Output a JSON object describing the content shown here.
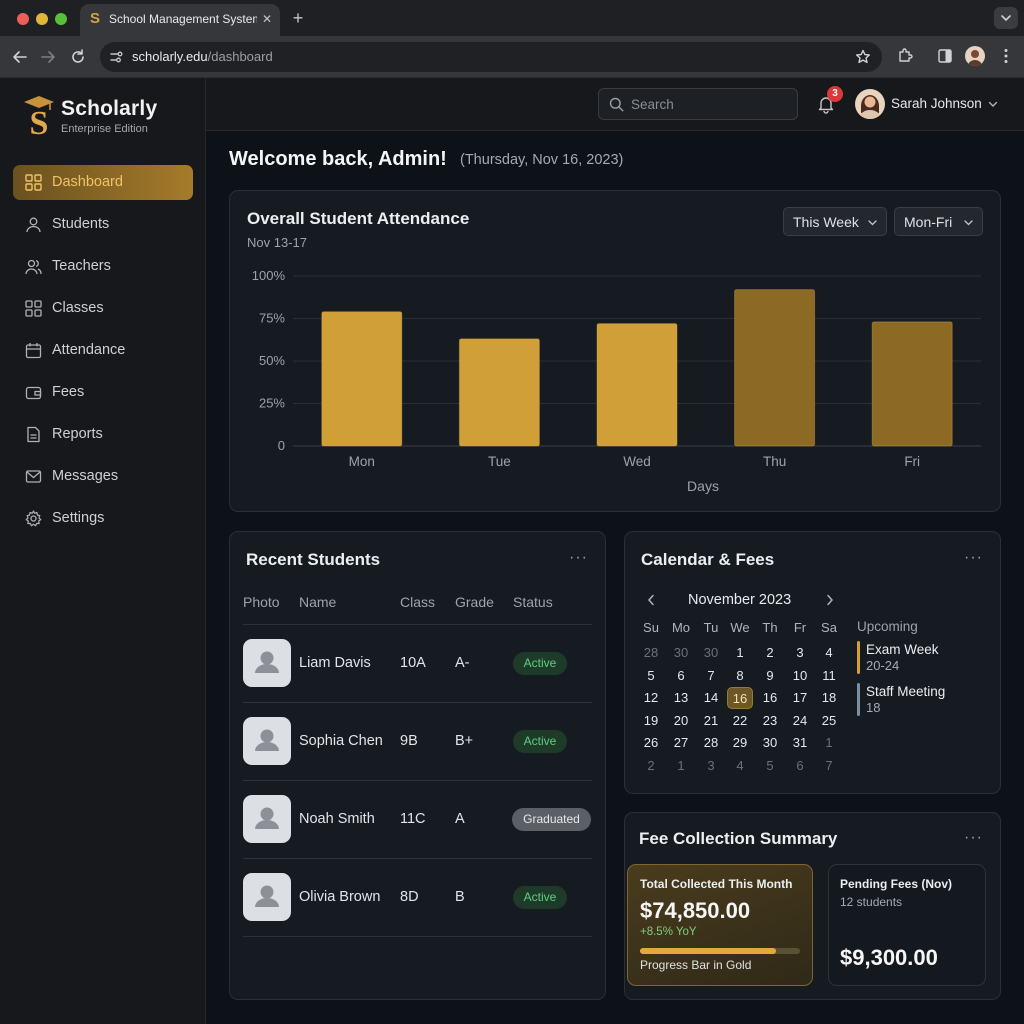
{
  "browser": {
    "tab_title": "School Management System",
    "url_host": "scholarly.edu",
    "url_path": "/dashboard"
  },
  "brand": {
    "name": "Scholarly",
    "subtitle": "Enterprise Edition",
    "accent": "#d6a43d"
  },
  "sidebar": {
    "items": [
      {
        "label": "Dashboard",
        "icon": "grid-icon",
        "active": true
      },
      {
        "label": "Students",
        "icon": "user-icon"
      },
      {
        "label": "Teachers",
        "icon": "users-icon"
      },
      {
        "label": "Classes",
        "icon": "grid-icon"
      },
      {
        "label": "Attendance",
        "icon": "calendar-icon"
      },
      {
        "label": "Fees",
        "icon": "wallet-icon"
      },
      {
        "label": "Reports",
        "icon": "file-icon"
      },
      {
        "label": "Messages",
        "icon": "mail-icon"
      },
      {
        "label": "Settings",
        "icon": "gear-icon"
      }
    ]
  },
  "header": {
    "search_placeholder": "Search",
    "notification_count": "3",
    "user_name": "Sarah Johnson"
  },
  "welcome": {
    "title": "Welcome back, Admin!",
    "date": "(Thursday, Nov 16, 2023)"
  },
  "attendance": {
    "title": "Overall Student Attendance",
    "subtitle": "Nov 13-17",
    "range_select": "This Week",
    "days_select": "Mon-Fri"
  },
  "chart_data": {
    "type": "bar",
    "title": "Overall Student Attendance",
    "subtitle": "Nov 13-17",
    "categories": [
      "Mon",
      "Tue",
      "Wed",
      "Thu",
      "Fri"
    ],
    "values": [
      79,
      63,
      72,
      92,
      73
    ],
    "ytick_labels": [
      "0",
      "25%",
      "50%",
      "75%",
      "100%"
    ],
    "yticks": [
      0,
      25,
      50,
      75,
      100
    ],
    "ylim": [
      0,
      100
    ],
    "xlabel": "Days",
    "ylabel": "",
    "grid": true,
    "bar_colors": [
      "#d19f37",
      "#d19f37",
      "#d19f37",
      "#8c6a24",
      "#8c6a24"
    ]
  },
  "students": {
    "title": "Recent Students",
    "columns": [
      "Photo",
      "Name",
      "Class",
      "Grade",
      "Status"
    ],
    "rows": [
      {
        "name": "Liam Davis",
        "class": "10A",
        "grade": "A-",
        "status": "Active"
      },
      {
        "name": "Sophia Chen",
        "class": "9B",
        "grade": "B+",
        "status": "Active"
      },
      {
        "name": "Noah Smith",
        "class": "11C",
        "grade": "A",
        "status": "Graduated"
      },
      {
        "name": "Olivia Brown",
        "class": "8D",
        "grade": "B",
        "status": "Active"
      }
    ]
  },
  "calendar": {
    "title": "Calendar & Fees",
    "month": "November 2023",
    "weekdays": [
      "Su",
      "Mo",
      "Tu",
      "We",
      "Th",
      "Fr",
      "Sa"
    ],
    "weeks": [
      [
        "28",
        "30",
        "30",
        "1",
        "2",
        "3",
        "4"
      ],
      [
        "5",
        "6",
        "7",
        "8",
        "9",
        "10",
        "11"
      ],
      [
        "12",
        "13",
        "14",
        "16",
        "16",
        "17",
        "18"
      ],
      [
        "19",
        "20",
        "21",
        "22",
        "23",
        "24",
        "25"
      ],
      [
        "26",
        "27",
        "28",
        "29",
        "30",
        "31",
        "1"
      ],
      [
        "2",
        "1",
        "3",
        "4",
        "5",
        "6",
        "7"
      ]
    ],
    "selected": "16",
    "upcoming_label": "Upcoming",
    "events": [
      {
        "title": "Exam Week",
        "date": "20-24",
        "color": "#d19f37"
      },
      {
        "title": "Staff Meeting",
        "date": "18",
        "color": "#7a8fa3"
      }
    ]
  },
  "fees": {
    "title": "Fee Collection Summary",
    "collected_label": "Total Collected This Month",
    "collected_amount": "$74,850.00",
    "yoy": "+8.5% YoY",
    "progress": 0.85,
    "progress_caption": "Progress Bar in Gold",
    "pending_label": "Pending Fees (Nov)",
    "pending_count": "12 students",
    "pending_amount": "$9,300.00"
  }
}
